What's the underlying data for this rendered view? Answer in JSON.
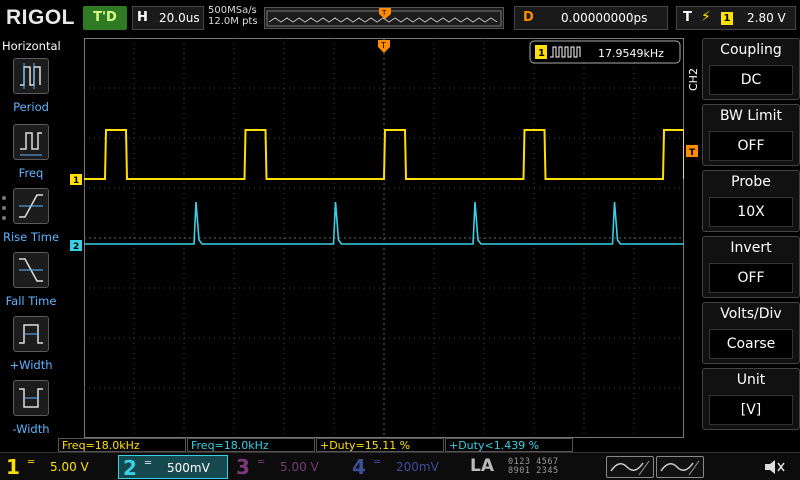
{
  "header": {
    "brand": "RIGOL",
    "run_status": "T'D",
    "horizontal_letter": "H",
    "timebase": "20.0us",
    "sample_rate": "500MSa/s",
    "memory_depth": "12.0M pts",
    "delay_letter": "D",
    "delay_value": "0.00000000ps",
    "trigger_letter": "T",
    "trigger_source": "1",
    "trigger_level": "2.80 V"
  },
  "left_panel": {
    "title": "Horizontal",
    "items": [
      {
        "label": "Period",
        "icon": "period-icon"
      },
      {
        "label": "Freq",
        "icon": "freq-icon"
      },
      {
        "label": "Rise Time",
        "icon": "rise-time-icon"
      },
      {
        "label": "Fall Time",
        "icon": "fall-time-icon"
      },
      {
        "label": "+Width",
        "icon": "positive-width-icon"
      },
      {
        "label": "-Width",
        "icon": "negative-width-icon"
      }
    ]
  },
  "display": {
    "counter_channel": "1",
    "counter_value": "17.9549kHz",
    "ch1_marker": "1",
    "ch2_marker": "2",
    "trigger_marker": "T"
  },
  "right_menu": {
    "channel_tab": "CH2",
    "items": [
      {
        "title": "Coupling",
        "value": "DC"
      },
      {
        "title": "BW Limit",
        "value": "OFF"
      },
      {
        "title": "Probe",
        "value": "10X"
      },
      {
        "title": "Invert",
        "value": "OFF"
      },
      {
        "title": "Volts/Div",
        "value": "Coarse"
      },
      {
        "title": "Unit",
        "value": "[V]"
      }
    ]
  },
  "measurements": [
    {
      "text": "Freq=18.0kHz"
    },
    {
      "text": "Freq=18.0kHz"
    },
    {
      "text": "+Duty=15.11 %"
    },
    {
      "text": "+Duty<1.439 %"
    }
  ],
  "channels": [
    {
      "num": "1",
      "scale": "5.00 V"
    },
    {
      "num": "2",
      "scale": "500mV"
    },
    {
      "num": "3",
      "scale": "5.00 V"
    },
    {
      "num": "4",
      "scale": "200mV"
    }
  ],
  "la": {
    "label": "LA",
    "digits_top": "0123 4567",
    "digits_bottom": "8901 2345"
  },
  "colors": {
    "ch1": "#ffe000",
    "ch2": "#38d0e6",
    "ch3": "#7a3a7a",
    "ch4": "#3d4f9a",
    "delay": "#ff8c00",
    "accent_blue": "#5fb4ff",
    "run_green": "#2f7a23"
  }
}
